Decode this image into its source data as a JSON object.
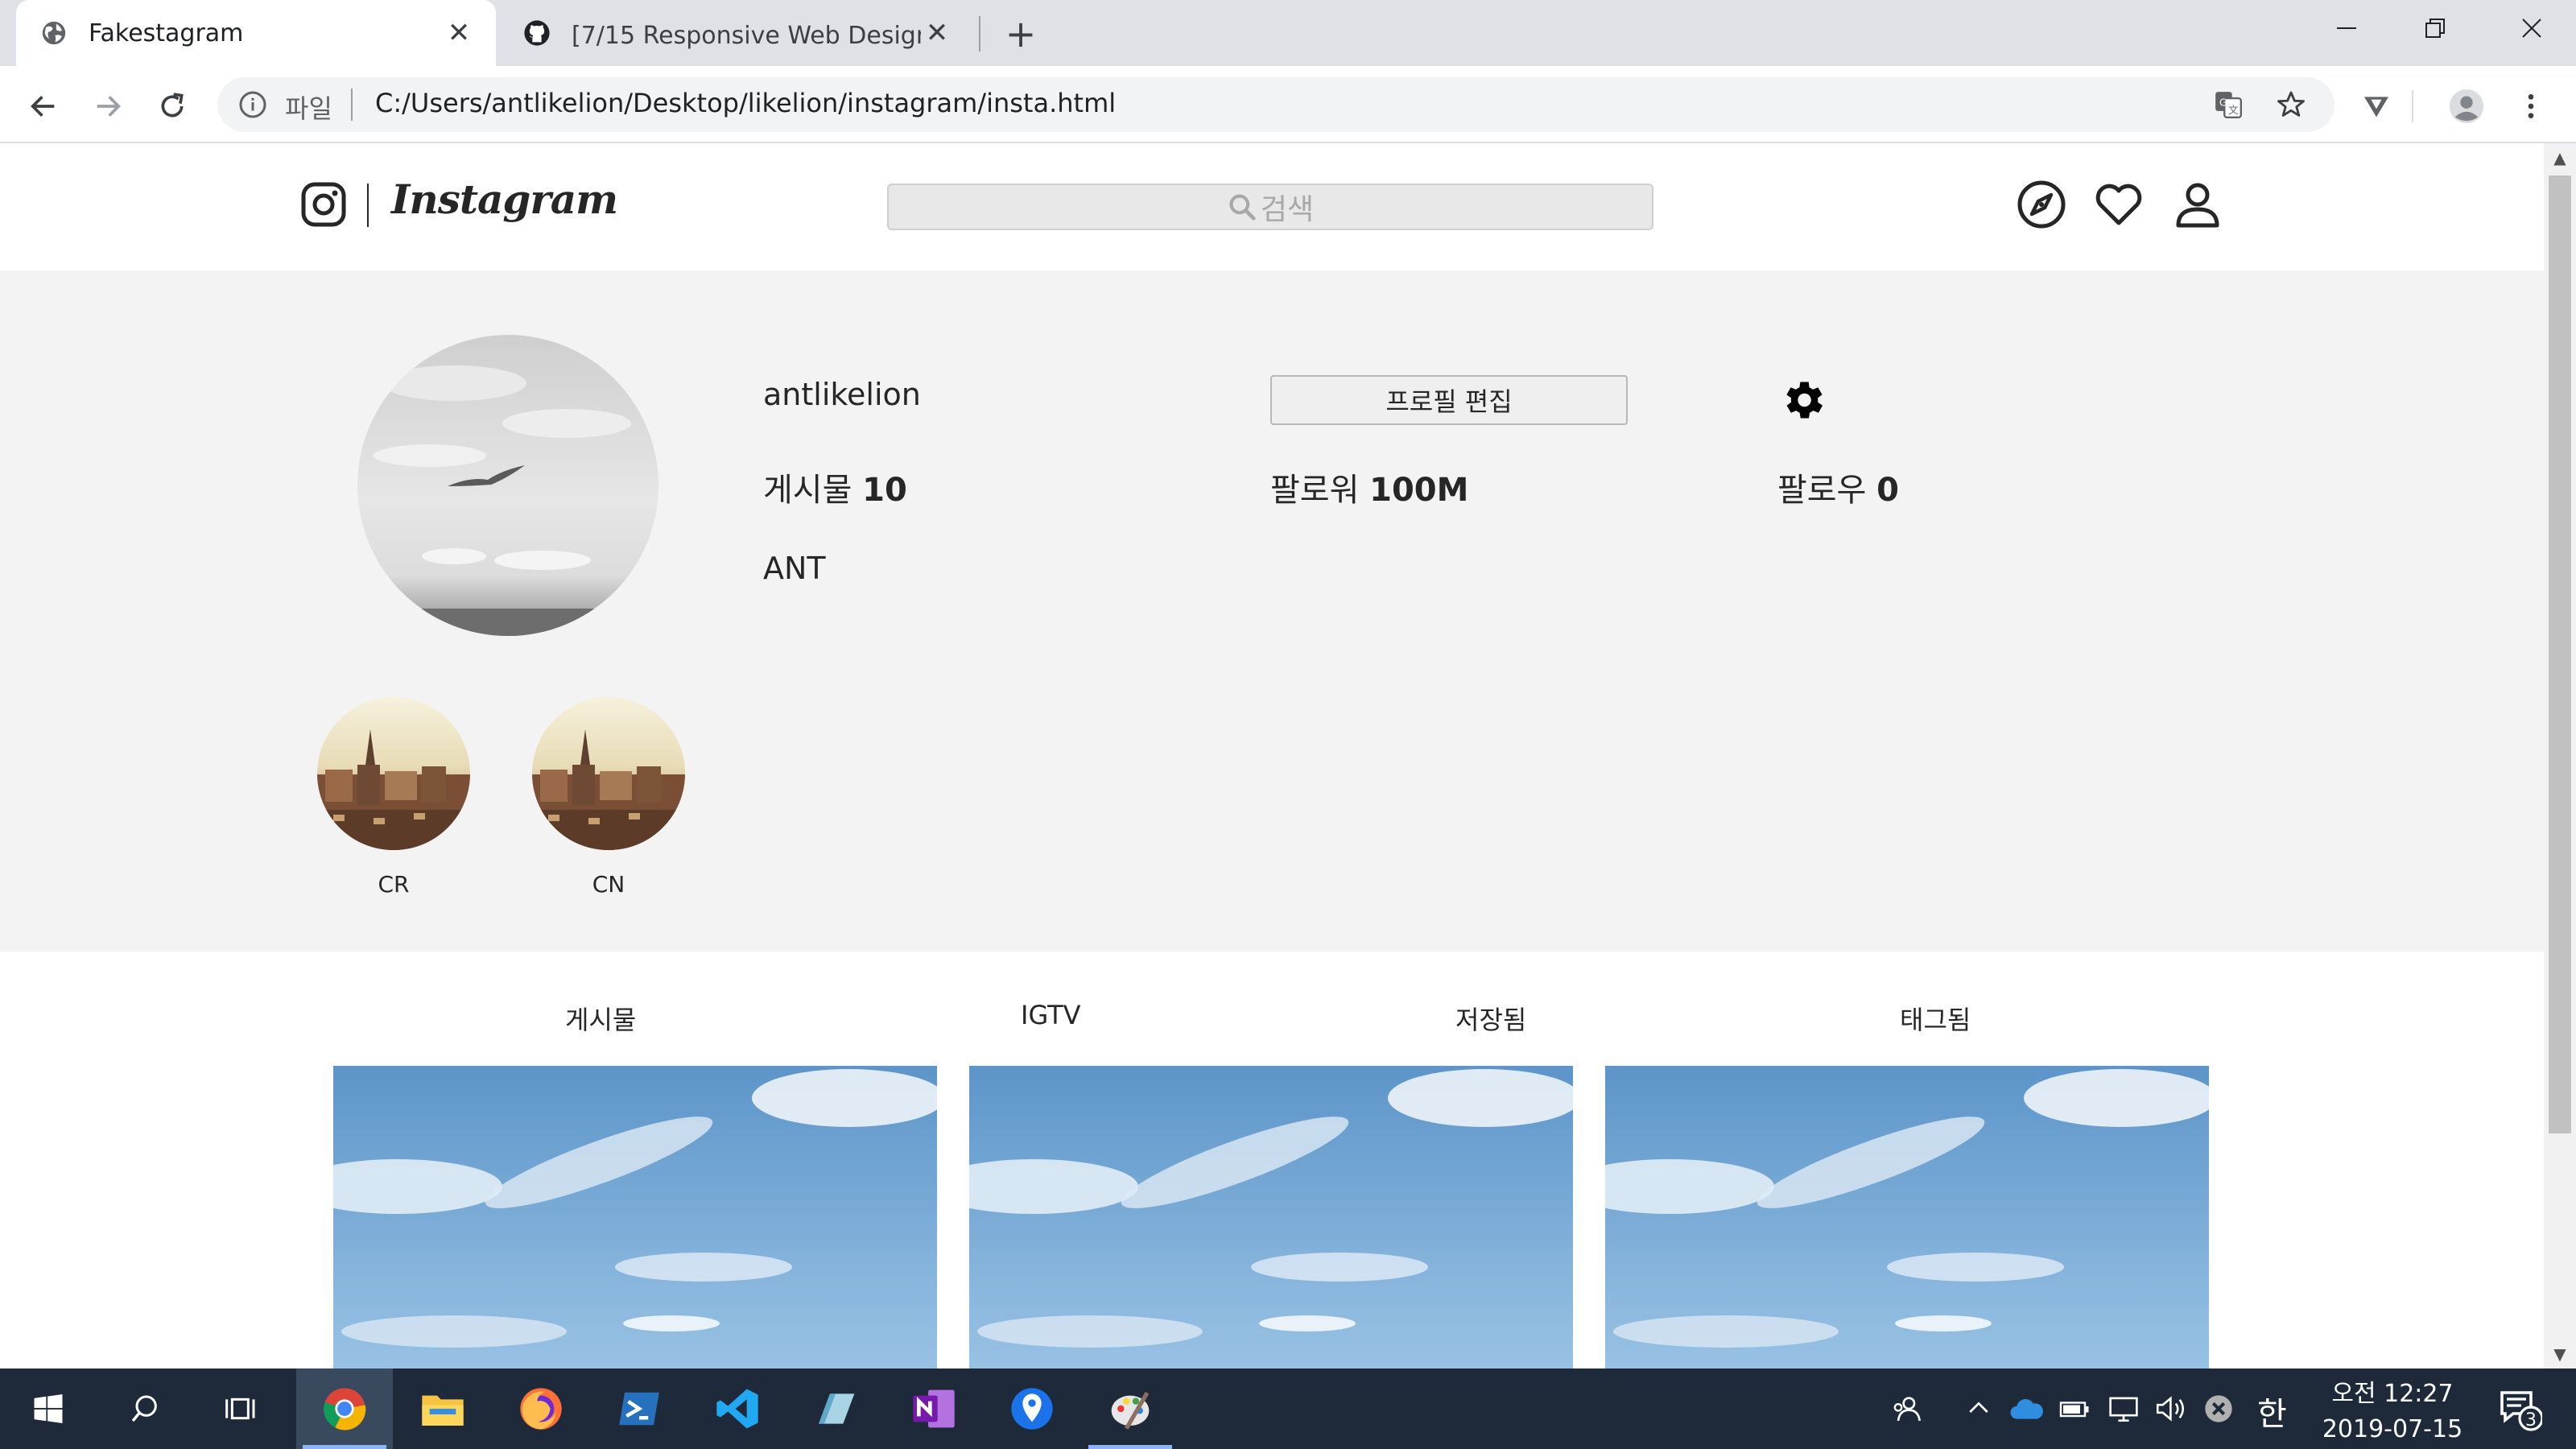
{
  "browser": {
    "tabs": [
      {
        "title": "Fakestagram",
        "icon": "globe-icon",
        "active": true
      },
      {
        "title": "[7/15 Responsive Web Design 고",
        "icon": "github-icon",
        "active": false
      }
    ],
    "address": {
      "scheme_label": "파일",
      "url": "C:/Users/antlikelion/Desktop/likelion/instagram/insta.html"
    }
  },
  "header": {
    "wordmark": "Instagram",
    "search_placeholder": "검색"
  },
  "profile": {
    "username": "antlikelion",
    "edit_button": "프로필 편집",
    "posts_label": "게시물",
    "posts_count": "10",
    "followers_label": "팔로워",
    "followers_count": "100M",
    "following_label": "팔로우",
    "following_count": "0",
    "display_name": "ANT",
    "highlights": [
      {
        "label": "CR"
      },
      {
        "label": "CN"
      }
    ]
  },
  "content_tabs": [
    "게시물",
    "IGTV",
    "저장됨",
    "태그됨"
  ],
  "taskbar": {
    "time": "오전 12:27",
    "date": "2019-07-15",
    "ime": "한",
    "notification_count": "3"
  },
  "colors": {
    "chrome_tabstrip": "#dee1e6",
    "profile_bg": "#f3f3f3",
    "taskbar_bg": "#1e2a3a",
    "text": "#262626"
  }
}
